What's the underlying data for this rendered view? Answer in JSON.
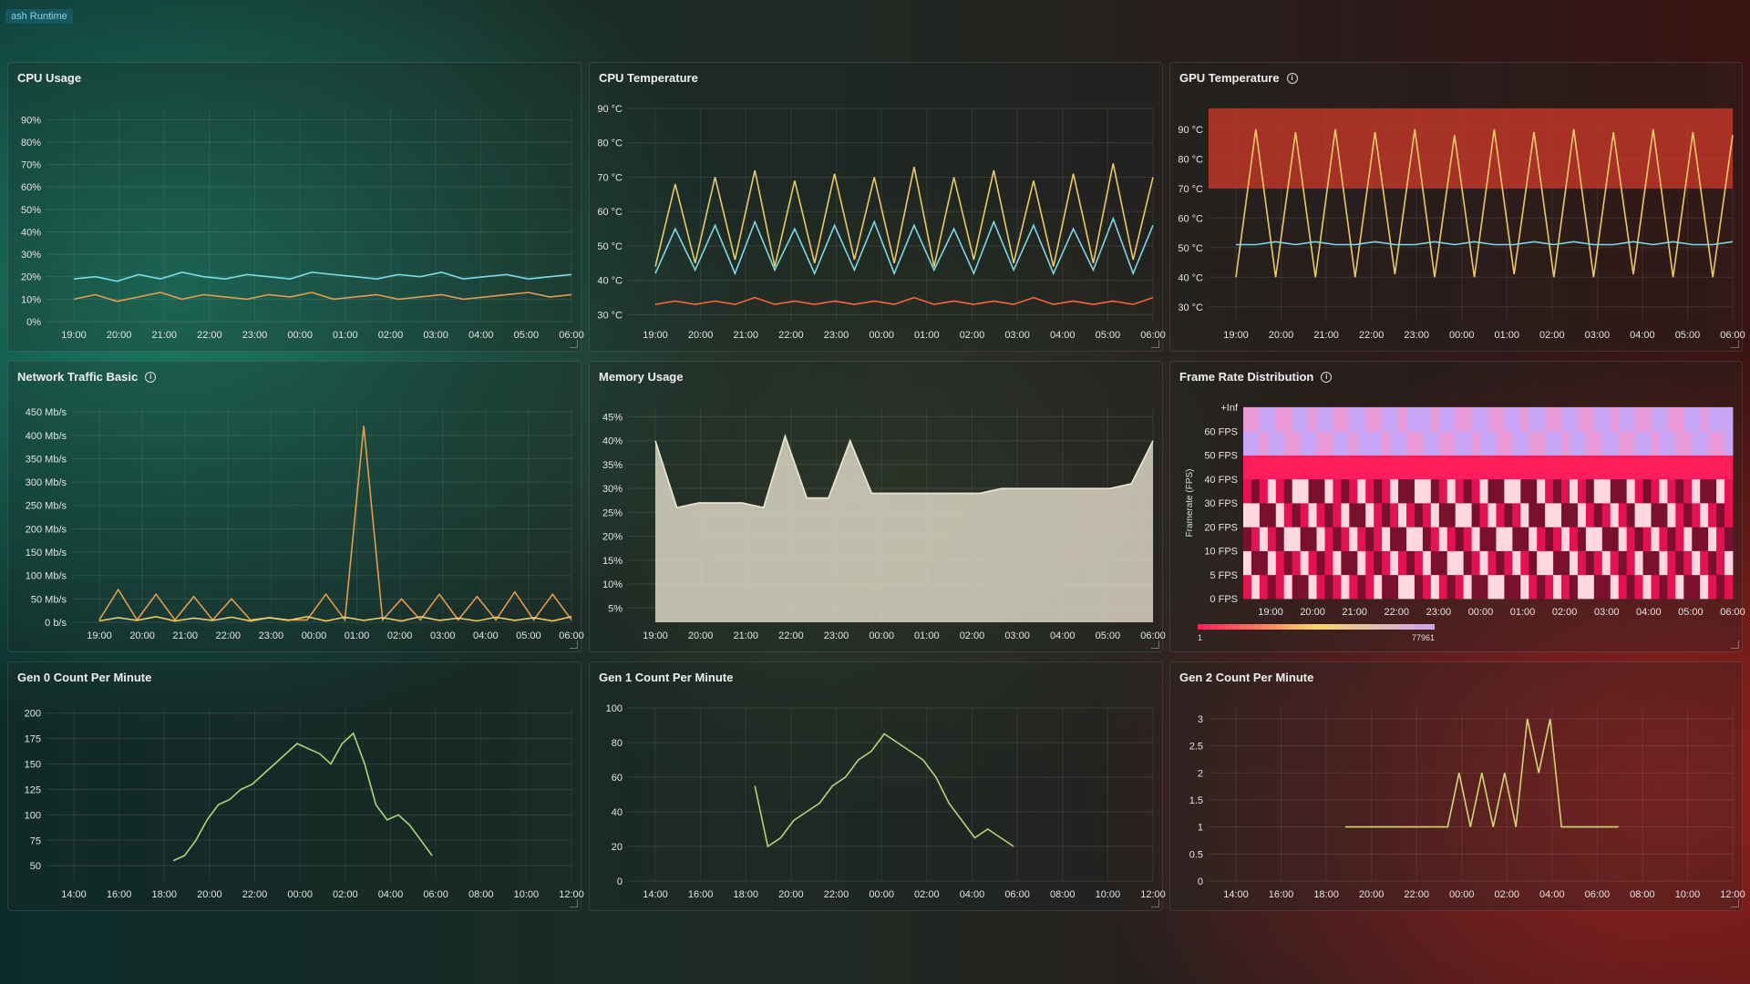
{
  "topbar": {
    "crumb": "ash Runtime"
  },
  "panels": [
    {
      "title": "CPU Usage",
      "info": false
    },
    {
      "title": "CPU Temperature",
      "info": false
    },
    {
      "title": "GPU Temperature",
      "info": true
    },
    {
      "title": "Network Traffic Basic",
      "info": true
    },
    {
      "title": "Memory Usage",
      "info": false
    },
    {
      "title": "Frame Rate Distribution",
      "info": true
    },
    {
      "title": "Gen 0 Count Per Minute",
      "info": false
    },
    {
      "title": "Gen 1 Count Per Minute",
      "info": false
    },
    {
      "title": "Gen 2 Count Per Minute",
      "info": false
    }
  ],
  "colors": {
    "series_cyan": "#7fe3ef",
    "series_orange": "#f0a050",
    "series_yellow": "#f5d36a",
    "series_pink": "#f6a0b0",
    "series_green": "#b8e07a",
    "heat_low": "#ff1d5c",
    "heat_high": "#c9a6f5",
    "threshold_red": "#d23a2a"
  },
  "chart_data": [
    {
      "type": "line",
      "title": "CPU Usage",
      "yticks": [
        "0%",
        "10%",
        "20%",
        "30%",
        "40%",
        "50%",
        "60%",
        "70%",
        "80%",
        "90%"
      ],
      "xticks": [
        "19:00",
        "20:00",
        "21:00",
        "22:00",
        "23:00",
        "00:00",
        "01:00",
        "02:00",
        "03:00",
        "04:00",
        "05:00",
        "06:00"
      ],
      "ylim": [
        0,
        95
      ],
      "series": [
        {
          "color": "#7fe3ef",
          "values": [
            19,
            20,
            18,
            21,
            19,
            22,
            20,
            19,
            21,
            20,
            19,
            22,
            21,
            20,
            19,
            21,
            20,
            22,
            19,
            20,
            21,
            19,
            20,
            21
          ]
        },
        {
          "color": "#f0a050",
          "values": [
            10,
            12,
            9,
            11,
            13,
            10,
            12,
            11,
            10,
            12,
            11,
            13,
            10,
            11,
            12,
            10,
            11,
            12,
            10,
            11,
            12,
            13,
            11,
            12
          ]
        }
      ]
    },
    {
      "type": "line",
      "title": "CPU Temperature",
      "yticks": [
        "30 °C",
        "40 °C",
        "50 °C",
        "60 °C",
        "70 °C",
        "80 °C",
        "90 °C"
      ],
      "xticks": [
        "19:00",
        "20:00",
        "21:00",
        "22:00",
        "23:00",
        "00:00",
        "01:00",
        "02:00",
        "03:00",
        "04:00",
        "05:00",
        "06:00"
      ],
      "ylim": [
        28,
        90
      ],
      "series": [
        {
          "color": "#f5d36a",
          "values": [
            44,
            68,
            45,
            70,
            46,
            72,
            44,
            69,
            45,
            71,
            46,
            70,
            45,
            73,
            44,
            70,
            46,
            72,
            45,
            69,
            44,
            71,
            45,
            74,
            46,
            70
          ]
        },
        {
          "color": "#7fe3ef",
          "values": [
            42,
            55,
            43,
            56,
            42,
            57,
            43,
            55,
            42,
            56,
            43,
            57,
            42,
            56,
            43,
            55,
            42,
            57,
            43,
            56,
            42,
            55,
            43,
            58,
            42,
            56
          ]
        },
        {
          "color": "#ff6a3a",
          "values": [
            33,
            34,
            33,
            34,
            33,
            35,
            33,
            34,
            33,
            34,
            33,
            34,
            33,
            35,
            33,
            34,
            33,
            34,
            33,
            35,
            33,
            34,
            33,
            34,
            33,
            35
          ]
        }
      ]
    },
    {
      "type": "line",
      "title": "GPU Temperature",
      "yticks": [
        "30 °C",
        "40 °C",
        "50 °C",
        "60 °C",
        "70 °C",
        "80 °C",
        "90 °C"
      ],
      "xticks": [
        "19:00",
        "20:00",
        "21:00",
        "22:00",
        "23:00",
        "00:00",
        "01:00",
        "02:00",
        "03:00",
        "04:00",
        "05:00",
        "06:00"
      ],
      "ylim": [
        25,
        97
      ],
      "thresholds": [
        {
          "from": 70,
          "to": 97,
          "color": "#d23a2a"
        }
      ],
      "series": [
        {
          "color": "#f5d36a",
          "values": [
            40,
            90,
            40,
            89,
            40,
            90,
            40,
            89,
            41,
            90,
            40,
            88,
            40,
            90,
            41,
            89,
            40,
            90,
            40,
            89,
            41,
            90,
            40,
            89,
            40,
            88
          ]
        },
        {
          "color": "#7fe3ef",
          "values": [
            51,
            51,
            52,
            51,
            52,
            51,
            51,
            52,
            51,
            51,
            52,
            51,
            52,
            51,
            51,
            52,
            51,
            52,
            51,
            51,
            52,
            51,
            52,
            51,
            51,
            52
          ]
        }
      ]
    },
    {
      "type": "line",
      "title": "Network Traffic Basic",
      "yticks": [
        "0 b/s",
        "50 Mb/s",
        "100 Mb/s",
        "150 Mb/s",
        "200 Mb/s",
        "250 Mb/s",
        "300 Mb/s",
        "350 Mb/s",
        "400 Mb/s",
        "450 Mb/s"
      ],
      "xticks": [
        "19:00",
        "20:00",
        "21:00",
        "22:00",
        "23:00",
        "00:00",
        "01:00",
        "02:00",
        "03:00",
        "04:00",
        "05:00",
        "06:00"
      ],
      "ylim": [
        0,
        460
      ],
      "series": [
        {
          "color": "#f0a050",
          "values": [
            5,
            70,
            5,
            60,
            5,
            55,
            5,
            50,
            5,
            10,
            5,
            5,
            60,
            5,
            420,
            5,
            50,
            5,
            60,
            5,
            55,
            5,
            65,
            5,
            60,
            5
          ]
        },
        {
          "color": "#f5d36a",
          "values": [
            3,
            10,
            4,
            12,
            3,
            9,
            4,
            11,
            3,
            10,
            4,
            12,
            3,
            11,
            4,
            10,
            3,
            12,
            4,
            9,
            3,
            11,
            4,
            10,
            3,
            12
          ]
        }
      ]
    },
    {
      "type": "area",
      "title": "Memory Usage",
      "yticks": [
        "5%",
        "10%",
        "15%",
        "20%",
        "25%",
        "30%",
        "35%",
        "40%",
        "45%"
      ],
      "xticks": [
        "19:00",
        "20:00",
        "21:00",
        "22:00",
        "23:00",
        "00:00",
        "01:00",
        "02:00",
        "03:00",
        "04:00",
        "05:00",
        "06:00"
      ],
      "ylim": [
        2,
        47
      ],
      "series": [
        {
          "color": "#f3ecd8",
          "values": [
            40,
            26,
            27,
            27,
            27,
            26,
            41,
            28,
            28,
            40,
            29,
            29,
            29,
            29,
            29,
            29,
            30,
            30,
            30,
            30,
            30,
            30,
            31,
            40
          ]
        }
      ]
    },
    {
      "type": "heatmap",
      "title": "Frame Rate Distribution",
      "ylabel": "Framerate (FPS)",
      "yticks": [
        "0 FPS",
        "5 FPS",
        "10 FPS",
        "20 FPS",
        "30 FPS",
        "40 FPS",
        "50 FPS",
        "60 FPS",
        "+Inf"
      ],
      "xticks": [
        "19:00",
        "20:00",
        "21:00",
        "22:00",
        "23:00",
        "00:00",
        "01:00",
        "02:00",
        "03:00",
        "04:00",
        "05:00",
        "06:00"
      ],
      "legend_min": "1",
      "legend_max": "77961"
    },
    {
      "type": "line",
      "title": "Gen 0 Count Per Minute",
      "yticks": [
        "50",
        "75",
        "100",
        "125",
        "150",
        "175",
        "200"
      ],
      "xticks": [
        "14:00",
        "16:00",
        "18:00",
        "20:00",
        "22:00",
        "00:00",
        "02:00",
        "04:00",
        "06:00",
        "08:00",
        "10:00",
        "12:00"
      ],
      "ylim": [
        35,
        205
      ],
      "series": [
        {
          "color": "#b8e07a",
          "values": [
            55,
            60,
            75,
            95,
            110,
            115,
            125,
            130,
            140,
            150,
            160,
            170,
            165,
            160,
            150,
            170,
            180,
            150,
            110,
            95,
            100,
            90,
            75,
            60
          ]
        }
      ]
    },
    {
      "type": "line",
      "title": "Gen 1 Count Per Minute",
      "yticks": [
        "0",
        "20",
        "40",
        "60",
        "80",
        "100"
      ],
      "xticks": [
        "14:00",
        "16:00",
        "18:00",
        "20:00",
        "22:00",
        "00:00",
        "02:00",
        "04:00",
        "06:00",
        "08:00",
        "10:00",
        "12:00"
      ],
      "ylim": [
        0,
        100
      ],
      "series": [
        {
          "color": "#b8e07a",
          "values": [
            55,
            20,
            25,
            35,
            40,
            45,
            55,
            60,
            70,
            75,
            85,
            80,
            75,
            70,
            60,
            45,
            35,
            25,
            30,
            25,
            20
          ]
        }
      ]
    },
    {
      "type": "line",
      "title": "Gen 2 Count Per Minute",
      "yticks": [
        "0",
        "0.5",
        "1",
        "1.5",
        "2",
        "2.5",
        "3"
      ],
      "xticks": [
        "14:00",
        "16:00",
        "18:00",
        "20:00",
        "22:00",
        "00:00",
        "02:00",
        "04:00",
        "06:00",
        "08:00",
        "10:00",
        "12:00"
      ],
      "ylim": [
        0,
        3.2
      ],
      "series": [
        {
          "color": "#d6e07a",
          "values": [
            1,
            1,
            1,
            1,
            1,
            1,
            1,
            1,
            1,
            1,
            2,
            1,
            2,
            1,
            2,
            1,
            3,
            2,
            3,
            1,
            1,
            1,
            1,
            1,
            1
          ]
        }
      ]
    }
  ]
}
